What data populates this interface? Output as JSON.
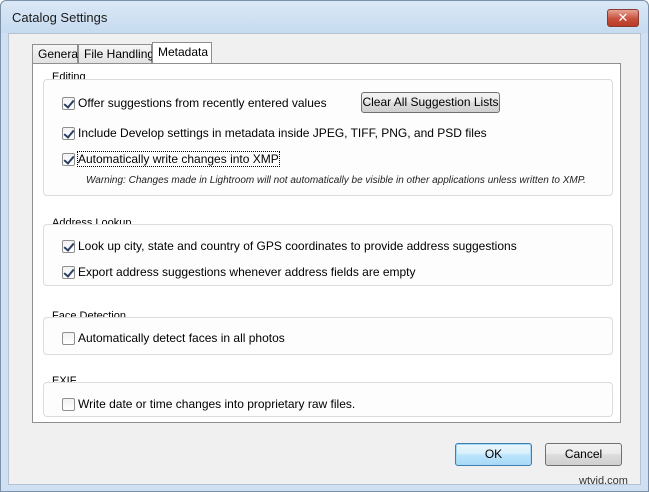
{
  "window": {
    "title": "Catalog Settings",
    "close_glyph": "✕"
  },
  "tabs": [
    {
      "label": "General"
    },
    {
      "label": "File Handling"
    },
    {
      "label": "Metadata"
    }
  ],
  "sections": {
    "editing": {
      "title": "Editing",
      "suggestions_label": "Offer suggestions from recently entered values",
      "suggestions_checked": true,
      "clear_button": "Clear All Suggestion Lists",
      "develop_label": "Include Develop settings in metadata inside JPEG, TIFF, PNG, and PSD files",
      "develop_checked": true,
      "xmp_label": "Automatically write changes into XMP",
      "xmp_checked": true,
      "warning": "Warning: Changes made in Lightroom will not automatically be visible in other applications unless written to XMP."
    },
    "address": {
      "title": "Address Lookup",
      "gps_label": "Look up city, state and country of GPS coordinates to provide address suggestions",
      "gps_checked": true,
      "export_label": "Export address suggestions whenever address fields are empty",
      "export_checked": true
    },
    "face": {
      "title": "Face Detection",
      "detect_label": "Automatically detect faces in all photos",
      "detect_checked": false
    },
    "exif": {
      "title": "EXIF",
      "write_label": "Write date or time changes into proprietary raw files.",
      "write_checked": false
    }
  },
  "footer": {
    "ok": "OK",
    "cancel": "Cancel"
  },
  "watermark": "wtvid.com"
}
